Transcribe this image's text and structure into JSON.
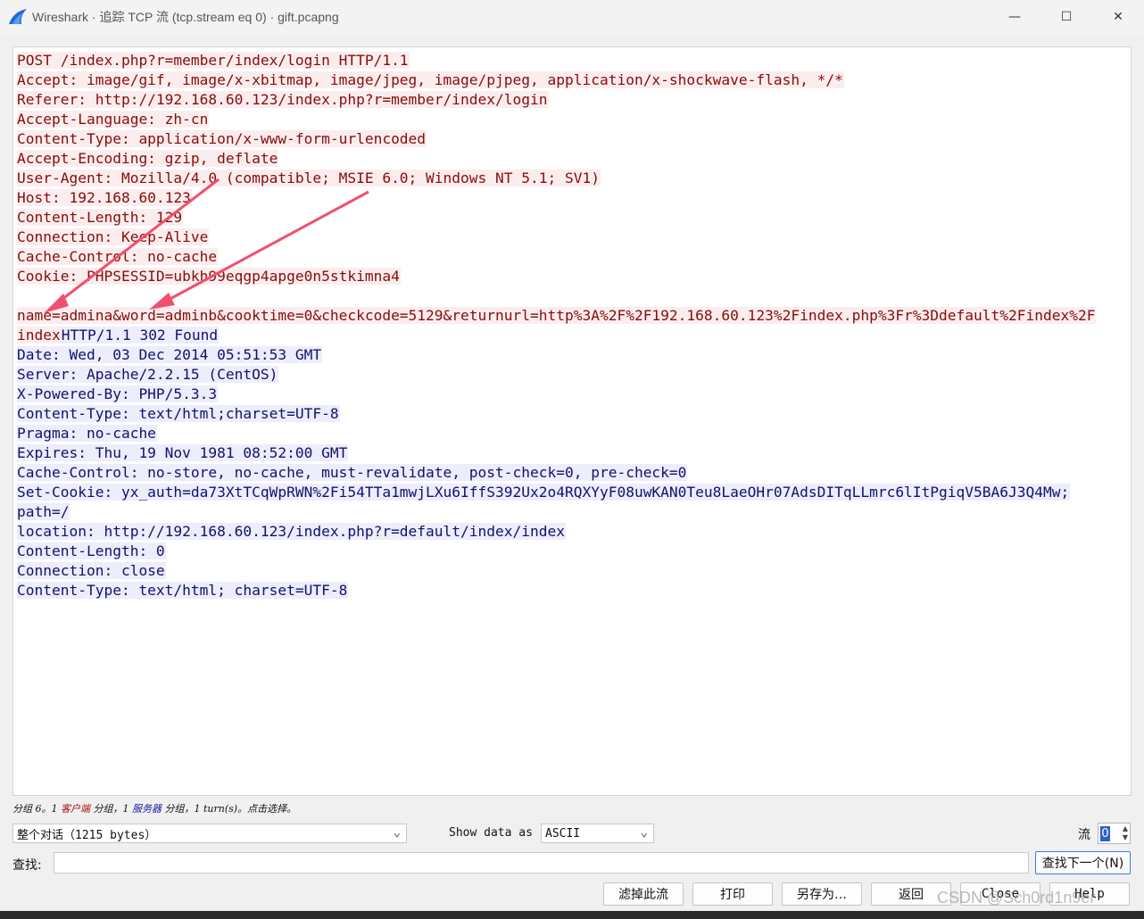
{
  "window": {
    "title": "Wireshark · 追踪 TCP 流 (tcp.stream eq 0) · gift.pcapng",
    "minimize": "—",
    "maximize": "☐",
    "close": "✕"
  },
  "stream": {
    "client_lines": [
      "POST /index.php?r=member/index/login HTTP/1.1",
      "Accept: image/gif, image/x-xbitmap, image/jpeg, image/pjpeg, application/x-shockwave-flash, */*",
      "Referer: http://192.168.60.123/index.php?r=member/index/login",
      "Accept-Language: zh-cn",
      "Content-Type: application/x-www-form-urlencoded",
      "Accept-Encoding: gzip, deflate",
      "User-Agent: Mozilla/4.0 (compatible; MSIE 6.0; Windows NT 5.1; SV1)",
      "Host: 192.168.60.123",
      "Content-Length: 129",
      "Connection: Keep-Alive",
      "Cache-Control: no-cache",
      "Cookie: PHPSESSID=ubkh99eqgp4apge0n5stkimna4",
      "",
      "name=admina&word=adminb&cooktime=0&checkcode=5129&returnurl=http%3A%2F%2F192.168.60.123%2Findex.php%3Fr%3Ddefault%2Findex%2F"
    ],
    "client_tail": "index",
    "server_first": "HTTP/1.1 302 Found",
    "server_lines": [
      "Date: Wed, 03 Dec 2014 05:51:53 GMT",
      "Server: Apache/2.2.15 (CentOS)",
      "X-Powered-By: PHP/5.3.3",
      "Content-Type: text/html;charset=UTF-8",
      "Pragma: no-cache",
      "Expires: Thu, 19 Nov 1981 08:52:00 GMT",
      "Cache-Control: no-store, no-cache, must-revalidate, post-check=0, pre-check=0",
      "Set-Cookie: yx_auth=da73XtTCqWpRWN%2Fi54TTa1mwjLXu6IffS392Ux2o4RQXYyF08uwKAN0Teu8LaeOHr07AdsDITqLLmrc6lItPgiqV5BA6J3Q4Mw;",
      "path=/",
      "location: http://192.168.60.123/index.php?r=default/index/index",
      "Content-Length: 0",
      "Connection: close",
      "Content-Type: text/html; charset=UTF-8"
    ],
    "annotation_color": "#f0506e"
  },
  "status": {
    "prefix": "分组 6。1 ",
    "client": "客户端",
    "middle": " 分组，1 ",
    "server": "服务器",
    "suffix": " 分组，1 turn(s)。点击选择。"
  },
  "controls": {
    "conversation_select": "整个对话（1215 bytes）",
    "show_data_label": "Show data as",
    "show_data_value": "ASCII",
    "stream_label": "流",
    "stream_value": "0",
    "find_label": "查找:",
    "find_value": "",
    "find_next": "查找下一个(N)"
  },
  "buttons": {
    "filter_out": "滤掉此流",
    "print": "打印",
    "save_as": "另存为…",
    "back": "返回",
    "close": "Close",
    "help": "Help"
  },
  "watermark": "CSDN @Sch0rd1n9er"
}
